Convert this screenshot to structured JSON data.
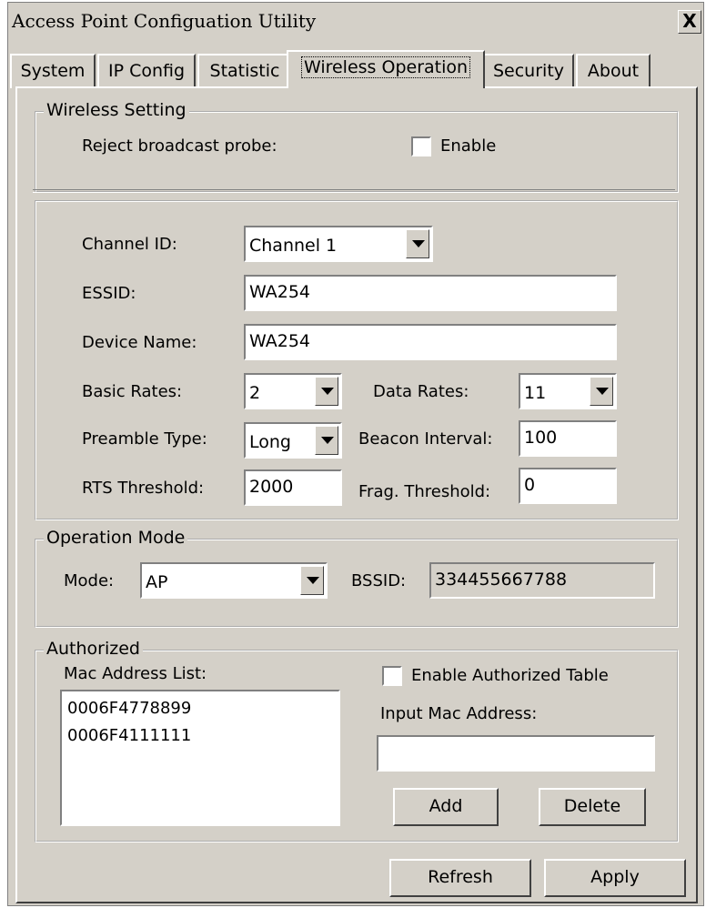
{
  "window": {
    "title": "Access Point Configuation Utility",
    "close_label": "X"
  },
  "tabs": [
    {
      "label": "System"
    },
    {
      "label": "IP Config"
    },
    {
      "label": "Statistic"
    },
    {
      "label": "Wireless Operation",
      "active": true
    },
    {
      "label": "Security"
    },
    {
      "label": "About"
    }
  ],
  "wireless_setting": {
    "legend": "Wireless Setting",
    "reject_label": "Reject broadcast probe:",
    "enable_label": "Enable",
    "enable_checked": false
  },
  "radio": {
    "channel_label": "Channel ID:",
    "channel_value": "Channel 1",
    "essid_label": "ESSID:",
    "essid_value": "WA254",
    "device_label": "Device Name:",
    "device_value": "WA254",
    "basic_label": "Basic Rates:",
    "basic_value": "2",
    "data_label": "Data Rates:",
    "data_value": "11",
    "preamble_label": "Preamble Type:",
    "preamble_value": "Long",
    "beacon_label": "Beacon Interval:",
    "beacon_value": "100",
    "rts_label": "RTS Threshold:",
    "rts_value": "2000",
    "frag_label": "Frag. Threshold:",
    "frag_value": "0"
  },
  "operation_mode": {
    "legend": "Operation Mode",
    "mode_label": "Mode:",
    "mode_value": "AP",
    "bssid_label": "BSSID:",
    "bssid_value": "334455667788"
  },
  "authorized": {
    "legend": "Authorized",
    "list_label": "Mac Address List:",
    "mac_list": [
      "0006F4778899",
      "0006F4111111"
    ],
    "enable_table_label": "Enable Authorized Table",
    "enable_table_checked": false,
    "input_label": "Input Mac Address:",
    "input_value": "",
    "add_label": "Add",
    "delete_label": "Delete"
  },
  "footer": {
    "refresh_label": "Refresh",
    "apply_label": "Apply"
  }
}
